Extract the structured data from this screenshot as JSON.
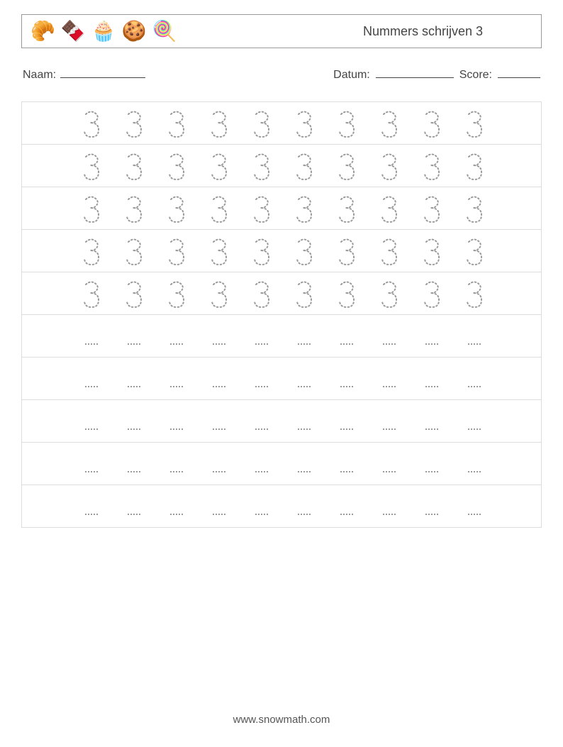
{
  "header": {
    "icons": [
      "croissant-icon",
      "chocolate-icon",
      "cupcake-icon",
      "cookie-icon",
      "popsicle-icon"
    ],
    "icon_glyphs": [
      "🥐",
      "🍫",
      "🧁",
      "🍪",
      "🍭"
    ],
    "title": "Nummers schrijven 3"
  },
  "info": {
    "name_label": "Naam:",
    "date_label": "Datum:",
    "score_label": "Score:"
  },
  "worksheet": {
    "traced_rows": 5,
    "blank_rows": 5,
    "cells_per_row": 10,
    "traced_value": "3"
  },
  "footer": {
    "url": "www.snowmath.com"
  }
}
